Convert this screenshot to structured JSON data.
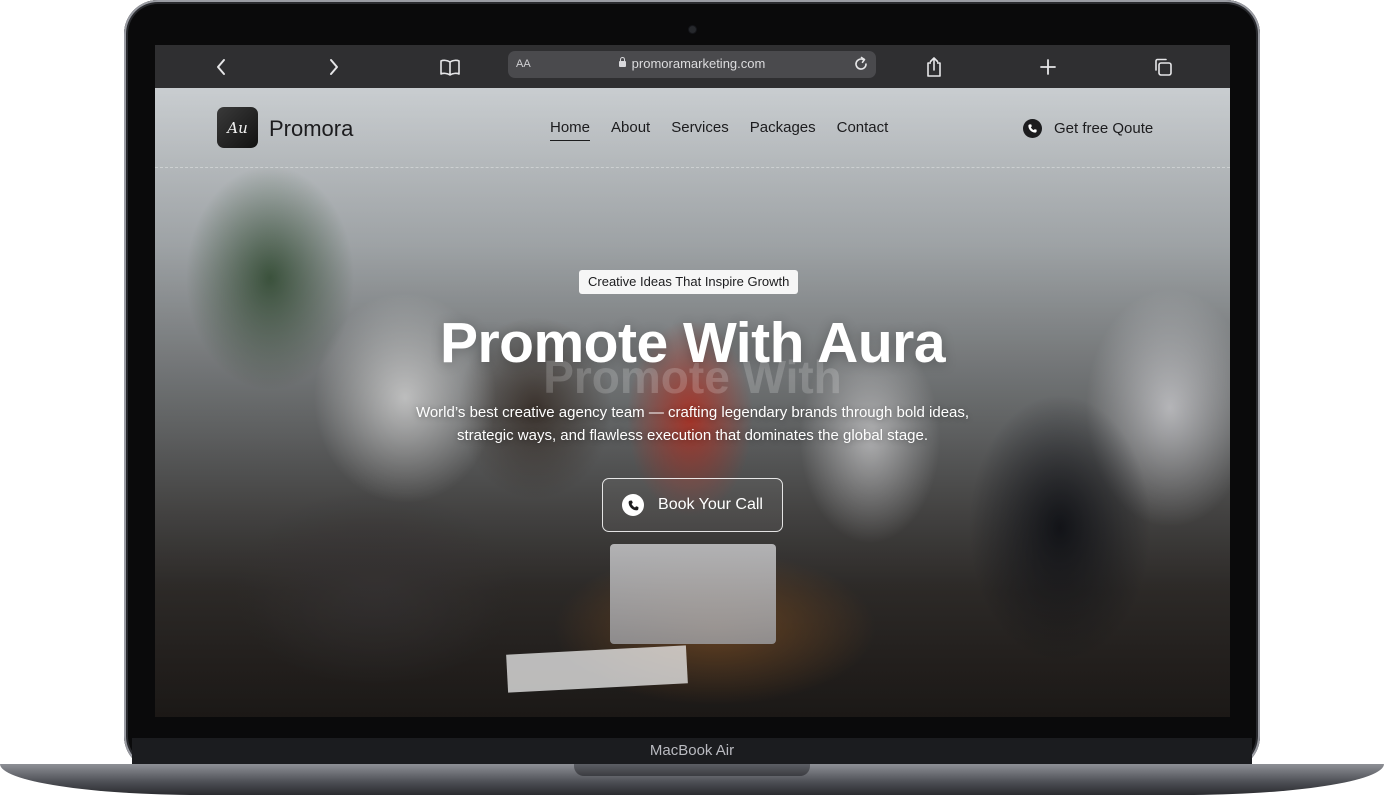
{
  "device": {
    "label": "MacBook Air"
  },
  "browser": {
    "text_size_label": "AA",
    "url": "promoramarketing.com",
    "icons": [
      "back-icon",
      "forward-icon",
      "bookmarks-icon",
      "lock-icon",
      "reload-icon",
      "share-icon",
      "new-tab-icon",
      "tabs-icon"
    ]
  },
  "site": {
    "brand": "Promora",
    "logo_text": "Au",
    "nav": [
      {
        "label": "Home",
        "active": true
      },
      {
        "label": "About"
      },
      {
        "label": "Services"
      },
      {
        "label": "Packages"
      },
      {
        "label": "Contact"
      }
    ],
    "quote_label": "Get free Qoute"
  },
  "hero": {
    "badge": "Creative Ideas That Inspire Growth",
    "headline": "Promote With Aura",
    "headline_shadow": "Promote With",
    "subtitle_line1": "World’s best creative agency team — crafting legendary brands through bold ideas,",
    "subtitle_line2": "strategic ways, and flawless execution that dominates the global stage.",
    "cta_label": "Book Your Call"
  },
  "colors": {
    "text_dark": "#1c1c1e",
    "white": "#ffffff",
    "toolbar": "#2f2f31"
  }
}
